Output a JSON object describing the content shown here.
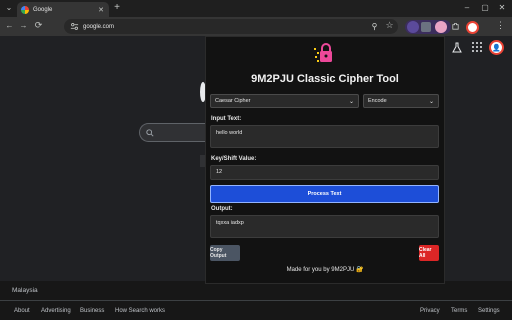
{
  "browser": {
    "tab_title": "Google",
    "tab_close": "✕",
    "new_tab": "+",
    "url": "google.com",
    "win_min": "–",
    "win_max": "▢",
    "win_close": "✕",
    "back": "←",
    "forward": "→",
    "reload": "⟳",
    "tab_search": "⌄"
  },
  "google_page": {
    "country": "Malaysia",
    "footer_left": [
      "About",
      "Advertising",
      "Business",
      "How Search works"
    ],
    "footer_right": [
      "Privacy",
      "Terms",
      "Settings"
    ]
  },
  "popup": {
    "title": "9M2PJU Classic Cipher Tool",
    "cipher_select": "Caesar Cipher",
    "mode_select": "Encode",
    "input_label": "Input Text:",
    "input_value": "hello world",
    "key_label": "Key/Shift Value:",
    "key_value": "12",
    "process_label": "Process Text",
    "output_label": "Output:",
    "output_value": "tqxxa iadxp",
    "copy_label": "Copy Output",
    "clear_label": "Clear All",
    "footer_text": "Made for you by 9M2PJU 🔐"
  },
  "colors": {
    "primary_button": "#1d4ed8",
    "danger_button": "#dc2626",
    "neutral_button": "#4b5563",
    "lock_icon": "#ec4899",
    "lock_sparkles": "#facc15"
  },
  "icons": [
    "google-favicon",
    "tab-close-icon",
    "new-tab-icon",
    "back-icon",
    "forward-icon",
    "reload-icon",
    "site-info-icon",
    "bookmark-star-icon",
    "extensions-icon",
    "lock-icon",
    "search-icon",
    "apps-grid-icon",
    "labs-flask-icon"
  ]
}
